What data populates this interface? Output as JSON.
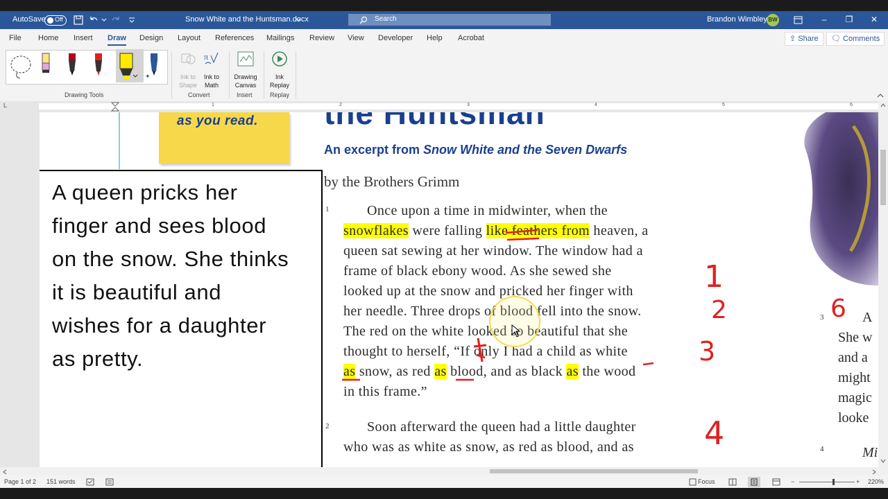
{
  "titlebar": {
    "autosave_label": "AutoSave",
    "autosave_state": "Off",
    "doc_title": "Snow White and the Huntsman.docx",
    "search_placeholder": "Search",
    "user_name": "Brandon Wimbley",
    "user_initials": "BW"
  },
  "menu": {
    "items": [
      "File",
      "Home",
      "Insert",
      "Draw",
      "Design",
      "Layout",
      "References",
      "Mailings",
      "Review",
      "View",
      "Developer",
      "Help",
      "Acrobat"
    ],
    "active": "Draw",
    "share_label": "Share",
    "comments_label": "Comments"
  },
  "ribbon": {
    "drawing_tools_label": "Drawing Tools",
    "convert_label": "Convert",
    "insert_label": "Insert",
    "replay_label": "Replay",
    "ink_to_shape": [
      "Ink to",
      "Shape"
    ],
    "ink_to_math": [
      "Ink to",
      "Math"
    ],
    "drawing_canvas": [
      "Drawing",
      "Canvas"
    ],
    "ink_replay": [
      "Ink",
      "Replay"
    ]
  },
  "ruler": {
    "numbers": [
      "1",
      "2",
      "3",
      "4",
      "5",
      "6"
    ]
  },
  "document": {
    "sticky_note": "as you read.",
    "heading_partial": "the Huntsman",
    "subtitle_prefix": "An excerpt from ",
    "subtitle_title": "Snow White and the Seven Dwarfs",
    "byline": "by the Brothers Grimm",
    "summary_lines": [
      "A queen pricks her",
      "finger and sees blood",
      "on the snow. She thinks",
      "it is beautiful and",
      "wishes for a daughter",
      "as pretty."
    ],
    "para1_number": "1",
    "para2_number": "2",
    "p1": {
      "l1": "Once upon a time in midwinter, when the",
      "l2_a": "snowflakes",
      "l2_b": " were falling ",
      "l2_c": "like feathers from",
      "l2_d": " heaven, a",
      "l3": "queen sat sewing at her window. The window had a",
      "l4": "frame of black ebony wood. As she sewed she",
      "l5": "looked up at the snow and pricked her finger with",
      "l6": "her needle. Three drops of blood fell into the snow.",
      "l7": "The red on the white looked so beautiful that she",
      "l8": "thought to herself, “If only I had a child as white",
      "l9_a": "as",
      "l9_b": " snow, as red ",
      "l9_c": "as",
      "l9_d": " blood, and as black ",
      "l9_e": "as",
      "l9_f": " the wood",
      "l10": "in this frame.”"
    },
    "p2": {
      "l1": "Soon afterward the queen had a little daughter",
      "l2": "who was as white as snow, as red as blood, and as"
    },
    "annotations": {
      "n1": "1",
      "n2": "2",
      "n3": "3",
      "n4": "4",
      "n6": "6"
    },
    "right_column": {
      "para3_number": "3",
      "para4_number": "4",
      "lines": [
        "A",
        "She w",
        "and a",
        "might",
        "magic",
        "looke"
      ],
      "fragment": "Mi"
    }
  },
  "status": {
    "page": "Page 1 of 2",
    "words": "151 words",
    "focus": "Focus",
    "zoom": "220%"
  }
}
